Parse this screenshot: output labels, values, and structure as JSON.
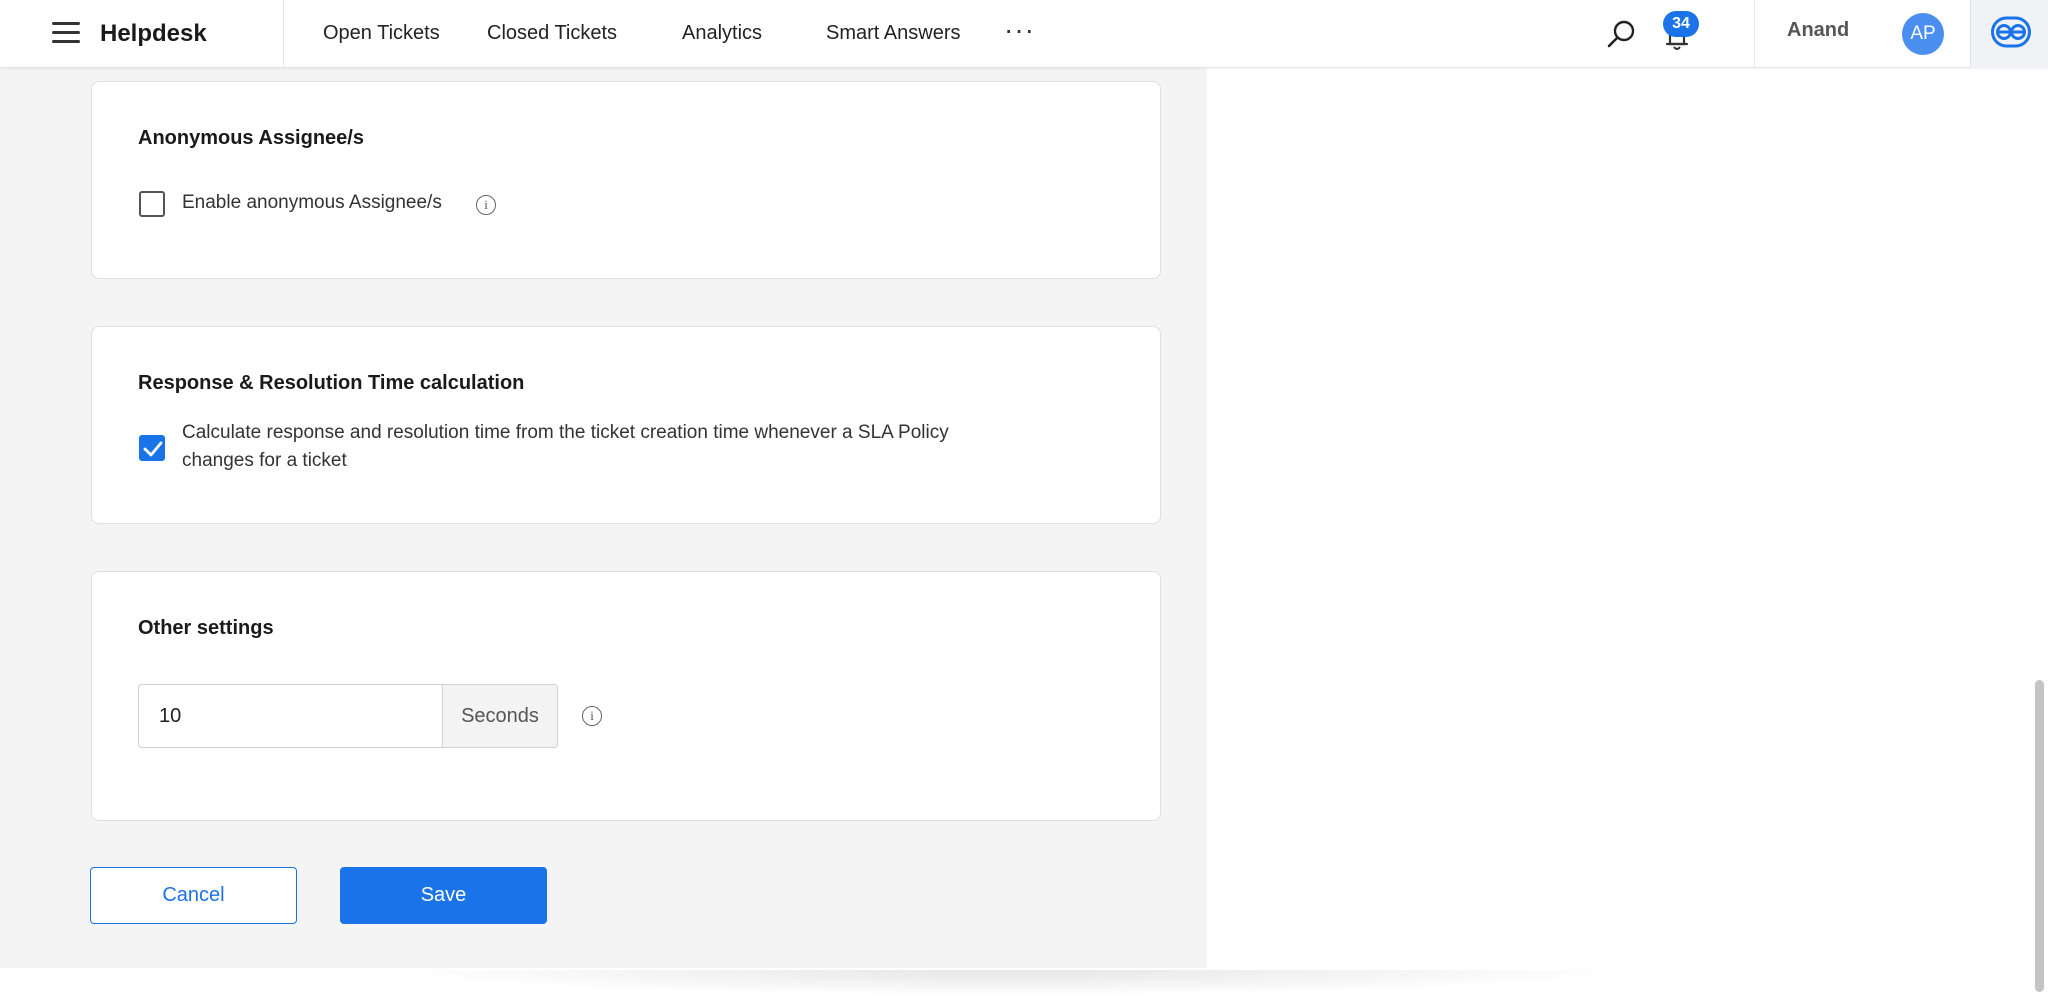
{
  "header": {
    "brand": "Helpdesk",
    "nav": [
      {
        "label": "Open Tickets"
      },
      {
        "label": "Closed Tickets"
      },
      {
        "label": "Analytics"
      },
      {
        "label": "Smart Answers"
      }
    ],
    "more": "···",
    "notification_count": "34",
    "user_name": "Anand",
    "avatar_initials": "AP"
  },
  "cards": {
    "anonymous": {
      "title": "Anonymous Assignee/s",
      "checkbox_label": "Enable anonymous Assignee/s",
      "checked": false
    },
    "response": {
      "title": "Response & Resolution Time calculation",
      "checkbox_label_line1": "Calculate response and resolution time from the ticket creation time whenever a SLA Policy",
      "checkbox_label_line2": "changes for a ticket",
      "checked": true
    },
    "other": {
      "title": "Other settings",
      "input_value": "10",
      "unit": "Seconds"
    }
  },
  "actions": {
    "cancel": "Cancel",
    "save": "Save"
  },
  "colors": {
    "accent": "#1a73e8",
    "avatar": "#4a8ff0"
  }
}
